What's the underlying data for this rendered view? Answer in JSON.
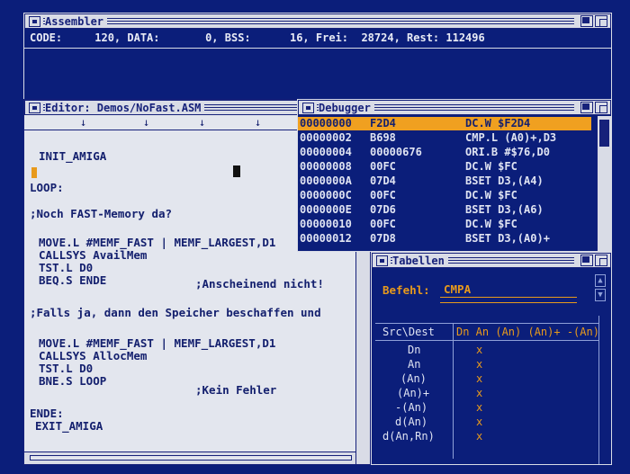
{
  "assembler": {
    "title": "Assembler",
    "status_line": "CODE:     120, DATA:       0, BSS:      16, Frei:  28724, Rest: 112496"
  },
  "editor": {
    "title": "Editor: Demos/NoFast.ASM",
    "lines": [
      "INIT_AMIGA",
      "LOOP:",
      ";Noch FAST-Memory da?",
      "MOVE.L #MEMF_FAST | MEMF_LARGEST,D1",
      "CALLSYS AvailMem",
      "TST.L D0",
      "BEQ.S ENDE",
      ";Anscheinend nicht!",
      ";Falls ja, dann den Speicher beschaffen und",
      "MOVE.L #MEMF_FAST | MEMF_LARGEST,D1",
      "CALLSYS AllocMem",
      "TST.L D0",
      "BNE.S LOOP",
      ";Kein Fehler",
      "ENDE:",
      "EXIT_AMIGA"
    ]
  },
  "debugger": {
    "title": "Debugger",
    "rows": [
      {
        "addr": "00000000",
        "code": "F2D4",
        "instr": "DC.W $F2D4"
      },
      {
        "addr": "00000002",
        "code": "B698",
        "instr": "CMP.L (A0)+,D3"
      },
      {
        "addr": "00000004",
        "code": "00000676",
        "instr": "ORI.B #$76,D0"
      },
      {
        "addr": "00000008",
        "code": "00FC",
        "instr": "DC.W $FC"
      },
      {
        "addr": "0000000A",
        "code": "07D4",
        "instr": "BSET D3,(A4)"
      },
      {
        "addr": "0000000C",
        "code": "00FC",
        "instr": "DC.W $FC"
      },
      {
        "addr": "0000000E",
        "code": "07D6",
        "instr": "BSET D3,(A6)"
      },
      {
        "addr": "00000010",
        "code": "00FC",
        "instr": "DC.W $FC"
      },
      {
        "addr": "00000012",
        "code": "07D8",
        "instr": "BSET D3,(A0)+"
      }
    ]
  },
  "tabellen": {
    "title": "Tabellen",
    "befehl_label": "Befehl:",
    "befehl_value": "CMPA",
    "header_src": "Src\\Dest",
    "header_dest": "Dn An (An) (An)+ -(An)",
    "rows": [
      "Dn",
      "An",
      "(An)",
      "(An)+",
      "-(An)",
      "d(An)",
      "d(An,Rn)"
    ],
    "mark": "x"
  }
}
